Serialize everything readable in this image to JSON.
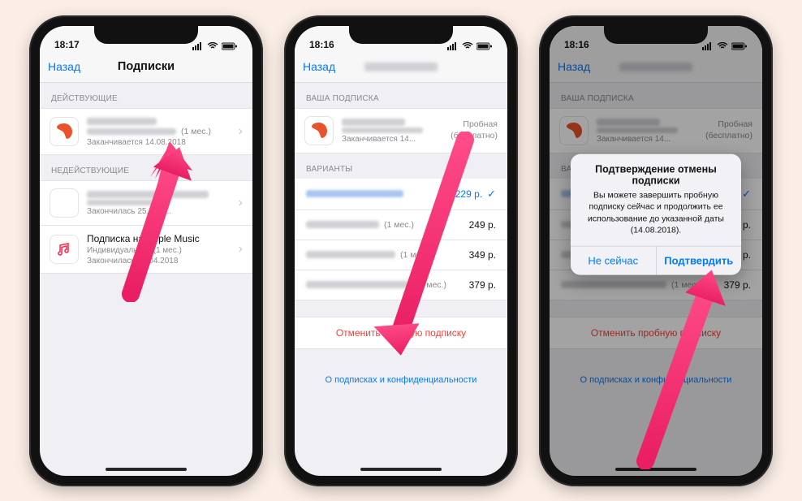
{
  "status": {
    "time1": "18:17",
    "time2": "18:16",
    "time3": "18:16"
  },
  "nav": {
    "back": "Назад",
    "title1": "Подписки"
  },
  "screen1": {
    "section_active": "ДЕЙСТВУЮЩИЕ",
    "sub_period": "(1 мес.)",
    "sub_expires": "Заканчивается 14.08.2018",
    "section_inactive": "НЕДЕЙСТВУЮЩИЕ",
    "row2_expires": "Закончилась 25.05.2...",
    "row3_title": "Подписка на Apple Music",
    "row3_sub": "Индивидуальная (1 мес.)",
    "row3_expires": "Закончилась 18.04.2018"
  },
  "screen2": {
    "section_your": "ВАША ПОДПИСКА",
    "trial_line1": "Пробная",
    "trial_line2": "(бесплатно)",
    "expires": "Заканчивается 14...",
    "section_variants": "ВАРИАНТЫ",
    "opt1_price": "229 р.",
    "opt2_suffix": "(1 мес.)",
    "opt2_price": "249 р.",
    "opt3_suffix": "(1 мес.)",
    "opt3_price": "349 р.",
    "opt4_suffix": "(1 мес.)",
    "opt4_price": "379 р.",
    "cancel": "Отменить пробную подписку",
    "privacy": "О подписках и конфиденциальности"
  },
  "screen3": {
    "alert_title": "Подтверждение отмены подписки",
    "alert_msg": "Вы можете завершить пробную подписку сейчас и продолжить ее использование до указанной даты (14.08.2018).",
    "btn_later": "Не сейчас",
    "btn_confirm": "Подтвердить"
  }
}
